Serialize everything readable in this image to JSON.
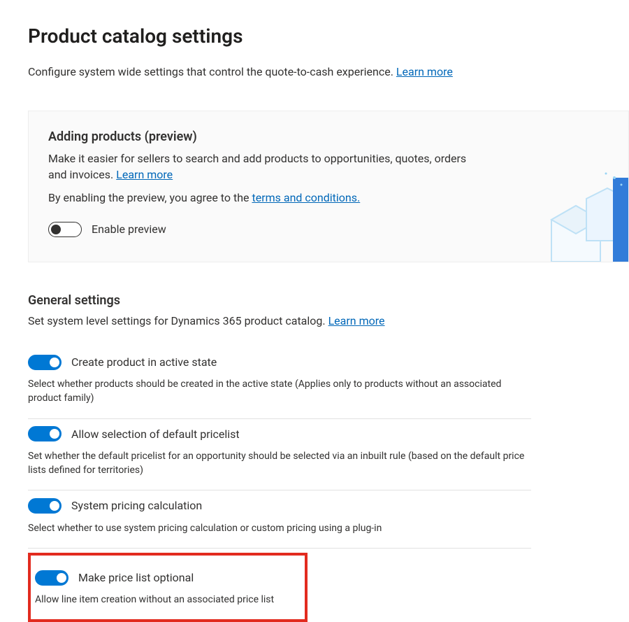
{
  "page": {
    "title": "Product catalog settings",
    "subtitle": "Configure system wide settings that control the quote-to-cash experience.",
    "learn_more": "Learn more"
  },
  "preview": {
    "title": "Adding products (preview)",
    "desc_prefix": "Make it easier for sellers to search and add products to opportunities, quotes, orders and invoices.",
    "learn_more": "Learn more",
    "terms_prefix": "By enabling the preview, you agree to the",
    "terms_link": "terms and conditions.",
    "toggle_label": "Enable preview",
    "toggle_on": false
  },
  "general": {
    "title": "General settings",
    "desc": "Set system level settings for Dynamics 365 product catalog.",
    "learn_more": "Learn more",
    "settings": [
      {
        "label": "Create product in active state",
        "on": true,
        "help": "Select whether products should be created in the active state (Applies only to products without an associated product family)"
      },
      {
        "label": "Allow selection of default pricelist",
        "on": true,
        "help": "Set whether the default pricelist for an opportunity should be selected via an inbuilt rule (based on the default price lists defined for territories)"
      },
      {
        "label": "System pricing calculation",
        "on": true,
        "help": "Select whether to use system pricing calculation or custom pricing using a plug-in"
      },
      {
        "label": "Make price list optional",
        "on": true,
        "help": "Allow line item creation without an associated price list"
      }
    ]
  }
}
